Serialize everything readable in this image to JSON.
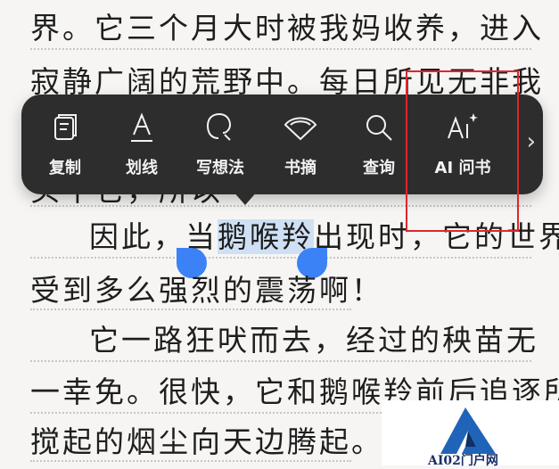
{
  "reader": {
    "lines": [
      "界。它三个月大时被我妈收养，进入",
      "寂静广阔的荒野中。每日所见无非我",
      "",
      "",
      "受到多么强烈的震荡啊！",
      "它一路狂吠而去，经过的秧苗无",
      "一幸免。很快，它和鹅喉羚前后追逐所",
      "搅起的烟尘向天边腾起。"
    ],
    "hidden_line_fragment": "头牛它，所以",
    "selection_line": {
      "before": "因此，当",
      "selected": "鹅喉羚",
      "after": "出现时，它的世界"
    }
  },
  "toolbar": {
    "items": [
      {
        "label": "复制",
        "icon": "copy-icon"
      },
      {
        "label": "划线",
        "icon": "underline-icon"
      },
      {
        "label": "写想法",
        "icon": "thought-bubble-icon"
      },
      {
        "label": "书摘",
        "icon": "excerpt-fan-icon"
      },
      {
        "label": "查询",
        "icon": "search-icon"
      },
      {
        "label": "AI 问书",
        "icon": "ai-sparkle-icon"
      }
    ],
    "more_icon": "chevron-right-icon",
    "more_glyph": "›"
  },
  "annotation": {
    "highlight_color": "#e0262a"
  },
  "watermark": {
    "text": "AI02门户网",
    "color": "#1a2f68"
  },
  "colors": {
    "selection": "#cfe0f4",
    "handle": "#3b82f6",
    "toolbar_bg": "#2d2d2d"
  }
}
